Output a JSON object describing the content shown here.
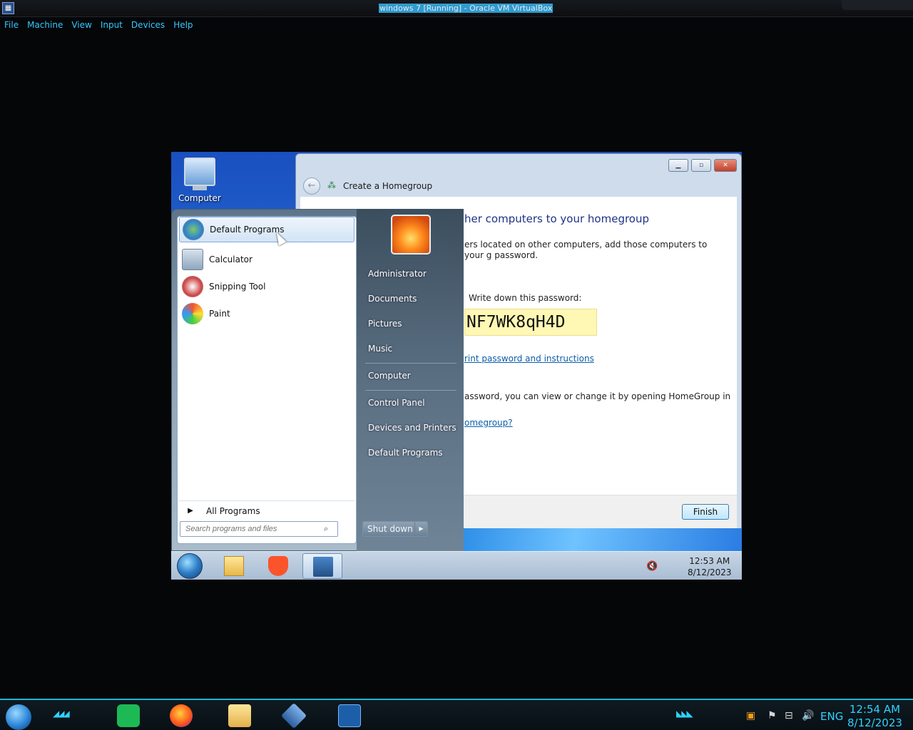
{
  "host": {
    "title": "windows 7 [Running] - Oracle VM VirtualBox",
    "menu": [
      "File",
      "Machine",
      "View",
      "Input",
      "Devices",
      "Help"
    ],
    "tray": {
      "language": "ENG",
      "time": "12:54 AM",
      "date": "8/12/2023"
    },
    "apps": [
      "hamburger-menu-icon",
      "spotify-icon",
      "firefox-icon",
      "file-manager-icon",
      "virtualbox-icon",
      "windows7-vm-icon"
    ]
  },
  "vm": {
    "desktop": {
      "computer_label": "Computer"
    },
    "homegroup": {
      "nav_title": "Create a Homegroup",
      "heading": "her computers to your homegroup",
      "para1": "ers located on other computers, add those computers to your g password.",
      "write_down": "Write down this password:",
      "password": "NF7WK8qH4D",
      "print_link": "rint password and instructions",
      "para2": "assword, you can view or change it by opening HomeGroup in",
      "link2": "omegroup?",
      "finish": "Finish"
    },
    "start_menu": {
      "programs": [
        {
          "label": "Default Programs",
          "icon": "default-programs-icon",
          "selected": true
        },
        {
          "label": "Calculator",
          "icon": "calculator-icon"
        },
        {
          "label": "Snipping Tool",
          "icon": "snipping-tool-icon"
        },
        {
          "label": "Paint",
          "icon": "paint-icon"
        }
      ],
      "all_programs": "All Programs",
      "search_placeholder": "Search programs and files",
      "right": {
        "administrator": "Administrator",
        "documents": "Documents",
        "pictures": "Pictures",
        "music": "Music",
        "computer": "Computer",
        "control_panel": "Control Panel",
        "devices_printers": "Devices and Printers",
        "default_programs": "Default Programs"
      },
      "shutdown": "Shut down"
    },
    "taskbar": {
      "time": "12:53 AM",
      "date": "8/12/2023"
    }
  }
}
